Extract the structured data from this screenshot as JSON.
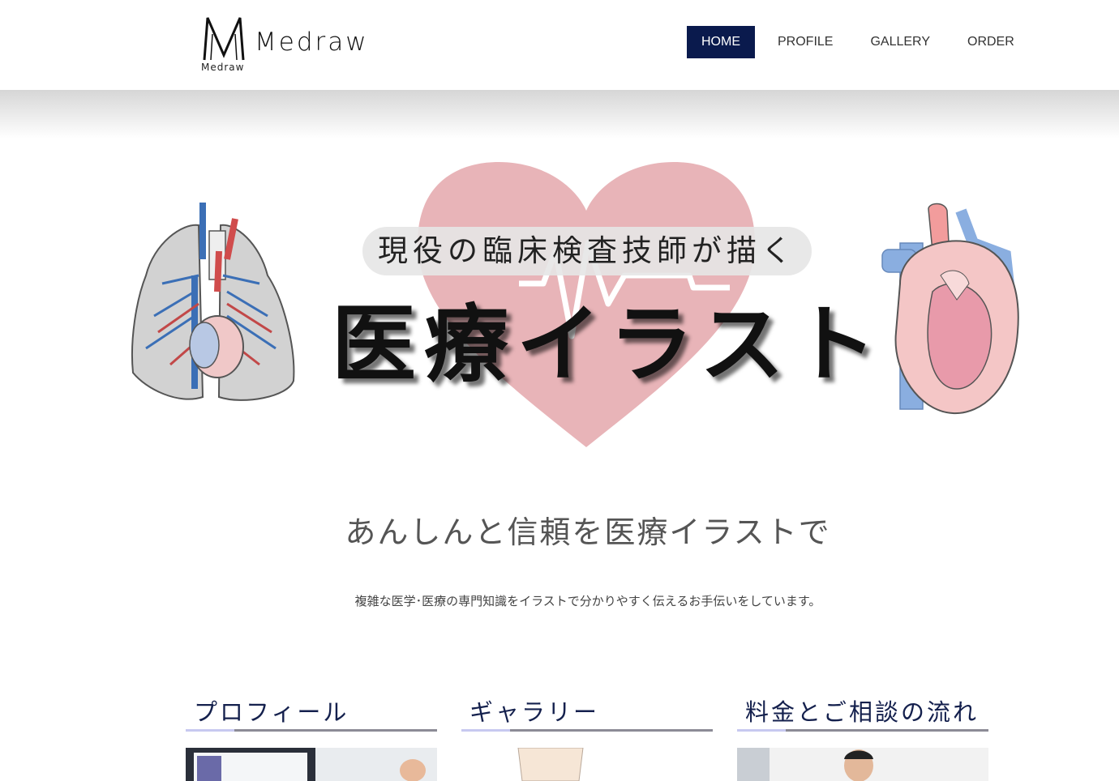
{
  "header": {
    "logo_wordmark": "Medraw",
    "logo_mark_letter": "M",
    "logo_mark_sub": "Medraw"
  },
  "nav": {
    "items": [
      {
        "label": "HOME",
        "active": true
      },
      {
        "label": "PROFILE",
        "active": false
      },
      {
        "label": "GALLERY",
        "active": false
      },
      {
        "label": "ORDER",
        "active": false
      }
    ]
  },
  "hero": {
    "subtitle": "現役の臨床検査技師が描く",
    "title": "医療イラスト"
  },
  "intro": {
    "tagline": "あんしんと信頼を医療イラストで",
    "description": "複雑な医学･医療の専門知識をイラストで分かりやすく伝えるお手伝いをしています。"
  },
  "cards": [
    {
      "title": "プロフィール"
    },
    {
      "title": "ギャラリー"
    },
    {
      "title": "料金とご相談の流れ"
    }
  ],
  "colors": {
    "nav_active_bg": "#0a1a4d",
    "heart": "#e8b4b8",
    "card_title": "#14204d",
    "card_rule": "#8c8b96",
    "card_rule_accent": "#c7c9f0"
  }
}
